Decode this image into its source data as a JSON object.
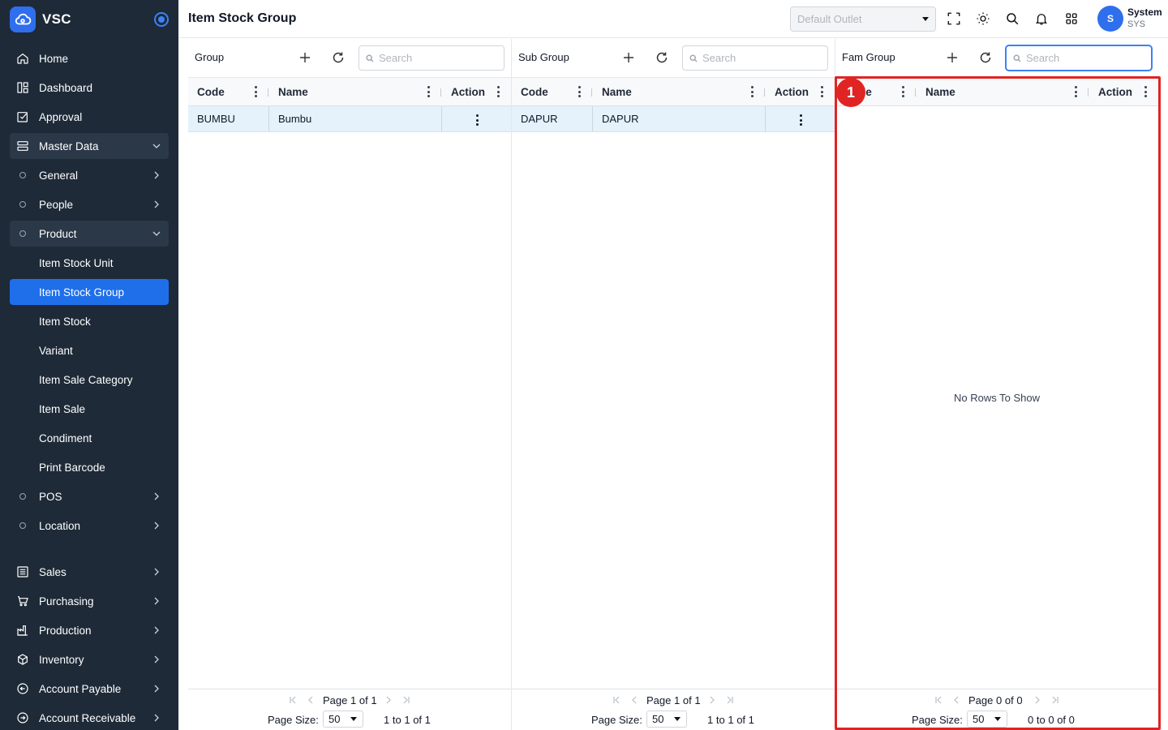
{
  "app": {
    "brand": "VSC"
  },
  "sidebar": {
    "items": [
      {
        "label": "Home",
        "icon": "home-icon"
      },
      {
        "label": "Dashboard",
        "icon": "dashboard-icon"
      },
      {
        "label": "Approval",
        "icon": "approval-icon"
      },
      {
        "label": "Master Data",
        "icon": "database-icon"
      },
      {
        "label": "General"
      },
      {
        "label": "People"
      },
      {
        "label": "Product"
      },
      {
        "label": "Item Stock Unit"
      },
      {
        "label": "Item Stock Group"
      },
      {
        "label": "Item Stock"
      },
      {
        "label": "Variant"
      },
      {
        "label": "Item Sale Category"
      },
      {
        "label": "Item Sale"
      },
      {
        "label": "Condiment"
      },
      {
        "label": "Print Barcode"
      },
      {
        "label": "POS"
      },
      {
        "label": "Location"
      },
      {
        "label": "Sales",
        "icon": "sales-icon"
      },
      {
        "label": "Purchasing",
        "icon": "cart-icon"
      },
      {
        "label": "Production",
        "icon": "factory-icon"
      },
      {
        "label": "Inventory",
        "icon": "box-icon"
      },
      {
        "label": "Account Payable",
        "icon": "arrow-left-circle-icon"
      },
      {
        "label": "Account Receivable",
        "icon": "arrow-right-circle-icon"
      }
    ]
  },
  "header": {
    "title": "Item Stock Group",
    "outlet_placeholder": "Default Outlet",
    "user": {
      "initial": "S",
      "name": "System",
      "code": "SYS"
    }
  },
  "panels": [
    {
      "title": "Group",
      "search_placeholder": "Search",
      "columns": [
        "Code",
        "Name",
        "Action"
      ],
      "rows": [
        {
          "code": "BUMBU",
          "name": "Bumbu"
        }
      ],
      "pager": {
        "page_label": "Page",
        "page": "1",
        "of_label": "of",
        "pages": "1",
        "size_label": "Page Size:",
        "size": "50",
        "from": "1",
        "to_label": "to",
        "to": "1",
        "of2_label": "of",
        "total": "1"
      }
    },
    {
      "title": "Sub Group",
      "search_placeholder": "Search",
      "columns": [
        "Code",
        "Name",
        "Action"
      ],
      "rows": [
        {
          "code": "DAPUR",
          "name": "DAPUR"
        }
      ],
      "pager": {
        "page_label": "Page",
        "page": "1",
        "of_label": "of",
        "pages": "1",
        "size_label": "Page Size:",
        "size": "50",
        "from": "1",
        "to_label": "to",
        "to": "1",
        "of2_label": "of",
        "total": "1"
      }
    },
    {
      "title": "Fam Group",
      "search_placeholder": "Search",
      "columns": [
        "Code",
        "Name",
        "Action"
      ],
      "rows": [],
      "empty_text": "No Rows To Show",
      "pager": {
        "page_label": "Page",
        "page": "0",
        "of_label": "of",
        "pages": "0",
        "size_label": "Page Size:",
        "size": "50",
        "from": "0",
        "to_label": "to",
        "to": "0",
        "of2_label": "of",
        "total": "0"
      }
    }
  ],
  "annotation": {
    "label": "1",
    "color": "#e02424"
  },
  "colors": {
    "sidebar_bg": "#1e2a38",
    "accent": "#1f6feb",
    "selected_row": "#e5f1fb"
  }
}
